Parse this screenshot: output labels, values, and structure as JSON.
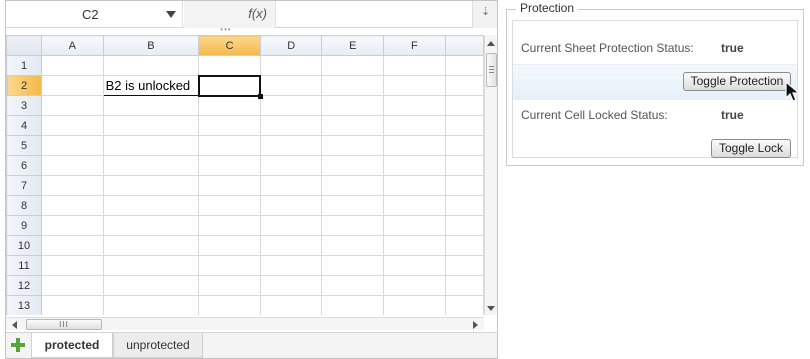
{
  "formula_bar": {
    "name_box": "C2",
    "fx_label": "f(x)",
    "splitter": "•••"
  },
  "grid": {
    "columns": [
      "A",
      "B",
      "C",
      "D",
      "E",
      "F"
    ],
    "rows": [
      "1",
      "2",
      "3",
      "4",
      "5",
      "6",
      "7",
      "8",
      "9",
      "10",
      "11",
      "12",
      "13"
    ],
    "active_cell": "C2",
    "cells": {
      "B2": "B2 is unlocked"
    }
  },
  "hscroll_grip": "III",
  "tabs": [
    {
      "label": "protected",
      "active": true
    },
    {
      "label": "unprotected",
      "active": false
    }
  ],
  "panel": {
    "title": "Protection",
    "sheet_status_label": "Current Sheet Protection Status:",
    "sheet_status_value": "true",
    "toggle_protection_label": "Toggle Protection",
    "cell_status_label": "Current Cell Locked Status:",
    "cell_status_value": "true",
    "toggle_lock_label": "Toggle Lock"
  },
  "colors": {
    "active_header": "#f5b94a",
    "add_sheet": "#5aa33a",
    "highlight_row": "#e6f0f9"
  },
  "icons": [
    "dropdown-caret-icon",
    "add-sheet-icon",
    "expand-icon",
    "mouse-cursor-icon"
  ]
}
